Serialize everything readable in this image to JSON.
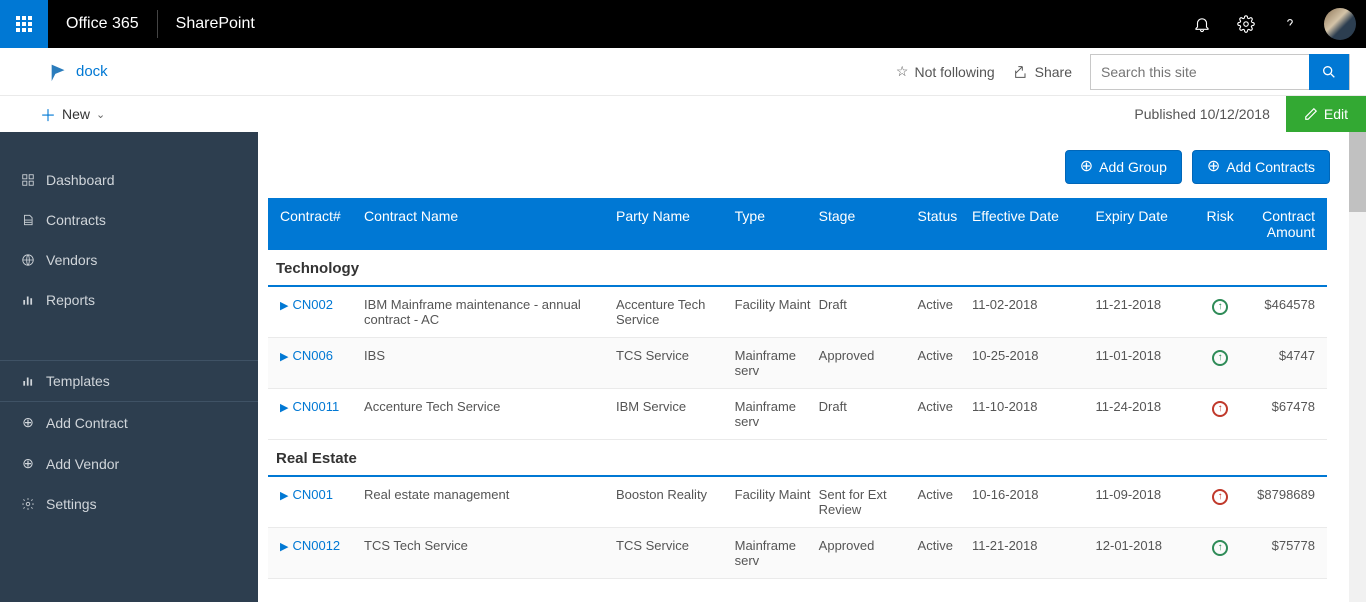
{
  "topbar": {
    "office": "Office 365",
    "sharepoint": "SharePoint"
  },
  "site": {
    "name": "dock",
    "not_following": "Not following",
    "share": "Share",
    "search_placeholder": "Search this site"
  },
  "toolbar": {
    "new": "New",
    "published": "Published 10/12/2018",
    "edit": "Edit"
  },
  "sidebar": {
    "items": [
      {
        "icon": "grid",
        "label": "Dashboard"
      },
      {
        "icon": "contracts",
        "label": "Contracts"
      },
      {
        "icon": "globe",
        "label": "Vendors"
      },
      {
        "icon": "chart",
        "label": "Reports"
      }
    ],
    "templates": {
      "label": "Templates"
    },
    "actions": [
      {
        "label": "Add Contract"
      },
      {
        "label": "Add Vendor"
      },
      {
        "label": "Settings"
      }
    ]
  },
  "buttons": {
    "add_group": "Add Group",
    "add_contracts": "Add Contracts"
  },
  "table": {
    "headers": {
      "num": "Contract#",
      "name": "Contract Name",
      "party": "Party Name",
      "type": "Type",
      "stage": "Stage",
      "status": "Status",
      "effective": "Effective Date",
      "expiry": "Expiry Date",
      "risk": "Risk",
      "amount": "Contract Amount"
    },
    "groups": [
      {
        "name": "Technology",
        "rows": [
          {
            "num": "CN002",
            "name": "IBM Mainframe maintenance - annual contract - AC",
            "party": "Accenture Tech Service",
            "type": "Facility Maint",
            "stage": "Draft",
            "status": "Active",
            "effective": "11-02-2018",
            "expiry": "11-21-2018",
            "risk": "green",
            "amount": "$464578"
          },
          {
            "num": "CN006",
            "name": "IBS",
            "party": "TCS Service",
            "type": "Mainframe serv",
            "stage": "Approved",
            "status": "Active",
            "effective": "10-25-2018",
            "expiry": "11-01-2018",
            "risk": "green",
            "amount": "$4747"
          },
          {
            "num": "CN0011",
            "name": "Accenture Tech Service",
            "party": "IBM Service",
            "type": "Mainframe serv",
            "stage": "Draft",
            "status": "Active",
            "effective": "11-10-2018",
            "expiry": "11-24-2018",
            "risk": "red",
            "amount": "$67478"
          }
        ]
      },
      {
        "name": "Real Estate",
        "rows": [
          {
            "num": "CN001",
            "name": "Real estate management",
            "party": "Booston Reality",
            "type": "Facility Maint",
            "stage": "Sent for Ext Review",
            "status": "Active",
            "effective": "10-16-2018",
            "expiry": "11-09-2018",
            "risk": "red",
            "amount": "$8798689"
          },
          {
            "num": "CN0012",
            "name": "TCS Tech Service",
            "party": "TCS Service",
            "type": "Mainframe serv",
            "stage": "Approved",
            "status": "Active",
            "effective": "11-21-2018",
            "expiry": "12-01-2018",
            "risk": "green",
            "amount": "$75778"
          }
        ]
      }
    ]
  }
}
